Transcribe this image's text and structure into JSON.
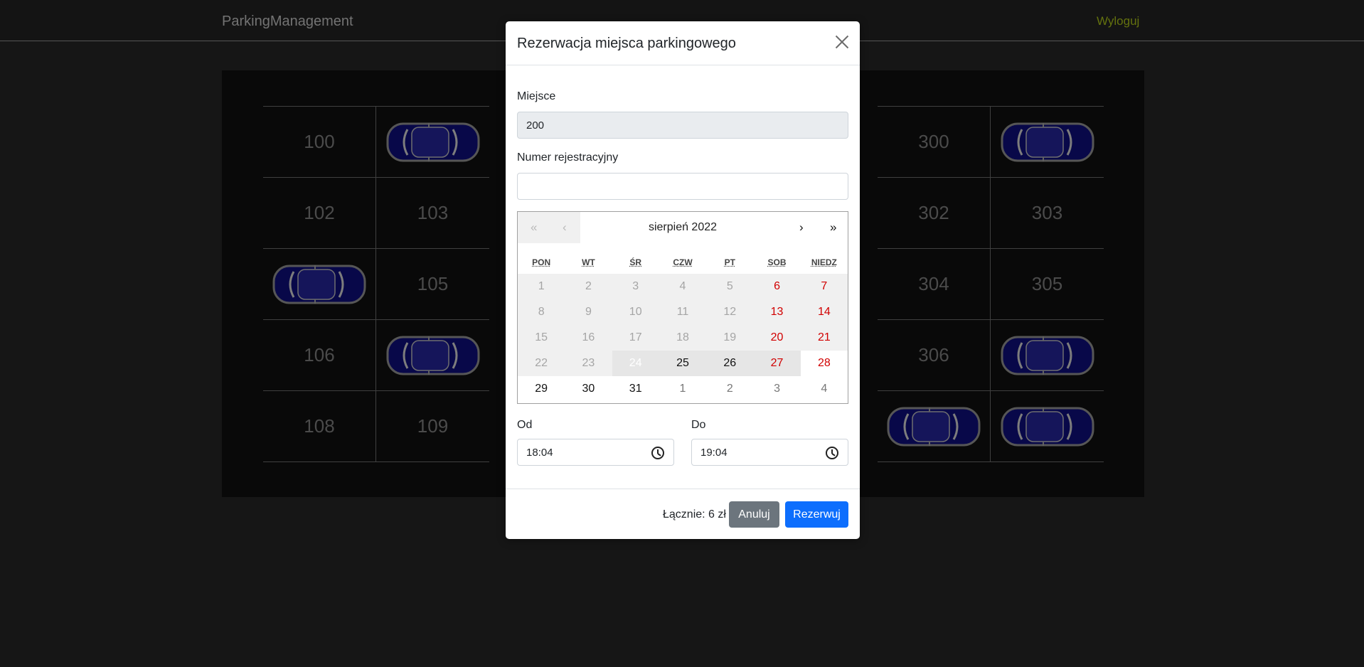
{
  "navbar": {
    "brand": "ParkingManagement",
    "logout": "Wyloguj"
  },
  "lot": {
    "left": [
      {
        "label": "100",
        "car": false
      },
      {
        "label": "",
        "car": true
      },
      {
        "label": "102",
        "car": false
      },
      {
        "label": "103",
        "car": false
      },
      {
        "label": "",
        "car": true
      },
      {
        "label": "105",
        "car": false
      },
      {
        "label": "106",
        "car": false
      },
      {
        "label": "",
        "car": true
      },
      {
        "label": "108",
        "car": false
      },
      {
        "label": "109",
        "car": false
      }
    ],
    "right": [
      {
        "label": "300",
        "car": false
      },
      {
        "label": "",
        "car": true
      },
      {
        "label": "302",
        "car": false
      },
      {
        "label": "303",
        "car": false
      },
      {
        "label": "304",
        "car": false
      },
      {
        "label": "305",
        "car": false
      },
      {
        "label": "306",
        "car": false
      },
      {
        "label": "",
        "car": true
      },
      {
        "label": "",
        "car": true
      },
      {
        "label": "",
        "car": true
      }
    ]
  },
  "modal": {
    "title": "Rezerwacja miejsca parkingowego",
    "spot_label": "Miejsce",
    "spot_value": "200",
    "plate_label": "Numer rejestracyjny",
    "plate_value": "",
    "calendar": {
      "month_label": "sierpień 2022",
      "prev_year": "«",
      "prev_month": "‹",
      "next_month": "›",
      "next_year": "»",
      "weekdays": [
        "PON",
        "WT",
        "ŚR",
        "CZW",
        "PT",
        "SOB",
        "NIEDZ"
      ],
      "days": [
        {
          "d": "1",
          "s": "past"
        },
        {
          "d": "2",
          "s": "past"
        },
        {
          "d": "3",
          "s": "past"
        },
        {
          "d": "4",
          "s": "past"
        },
        {
          "d": "5",
          "s": "past"
        },
        {
          "d": "6",
          "s": "past weekend"
        },
        {
          "d": "7",
          "s": "past weekend"
        },
        {
          "d": "8",
          "s": "past"
        },
        {
          "d": "9",
          "s": "past"
        },
        {
          "d": "10",
          "s": "past"
        },
        {
          "d": "11",
          "s": "past"
        },
        {
          "d": "12",
          "s": "past"
        },
        {
          "d": "13",
          "s": "past weekend"
        },
        {
          "d": "14",
          "s": "past weekend"
        },
        {
          "d": "15",
          "s": "past"
        },
        {
          "d": "16",
          "s": "past"
        },
        {
          "d": "17",
          "s": "past"
        },
        {
          "d": "18",
          "s": "past"
        },
        {
          "d": "19",
          "s": "past"
        },
        {
          "d": "20",
          "s": "past weekend"
        },
        {
          "d": "21",
          "s": "past weekend"
        },
        {
          "d": "22",
          "s": "past"
        },
        {
          "d": "23",
          "s": "past"
        },
        {
          "d": "24",
          "s": "today"
        },
        {
          "d": "25",
          "s": "range"
        },
        {
          "d": "26",
          "s": "range"
        },
        {
          "d": "27",
          "s": "range weekend"
        },
        {
          "d": "28",
          "s": "weekend"
        },
        {
          "d": "29",
          "s": ""
        },
        {
          "d": "30",
          "s": ""
        },
        {
          "d": "31",
          "s": ""
        },
        {
          "d": "1",
          "s": "other"
        },
        {
          "d": "2",
          "s": "other"
        },
        {
          "d": "3",
          "s": "other"
        },
        {
          "d": "4",
          "s": "other"
        }
      ]
    },
    "from_label": "Od",
    "from_value": "18:04",
    "to_label": "Do",
    "to_value": "19:04",
    "total": "Łącznie: 6 zł",
    "cancel_label": "Anuluj",
    "submit_label": "Rezerwuj"
  },
  "colors": {
    "car": "#0a0a5a",
    "primary": "#0d6efd",
    "secondary": "#6c757d",
    "weekend": "#d10000",
    "logout": "#7b8b12"
  },
  "icons": {
    "close": "close-icon",
    "clock": "clock-icon",
    "car": "car-icon"
  }
}
